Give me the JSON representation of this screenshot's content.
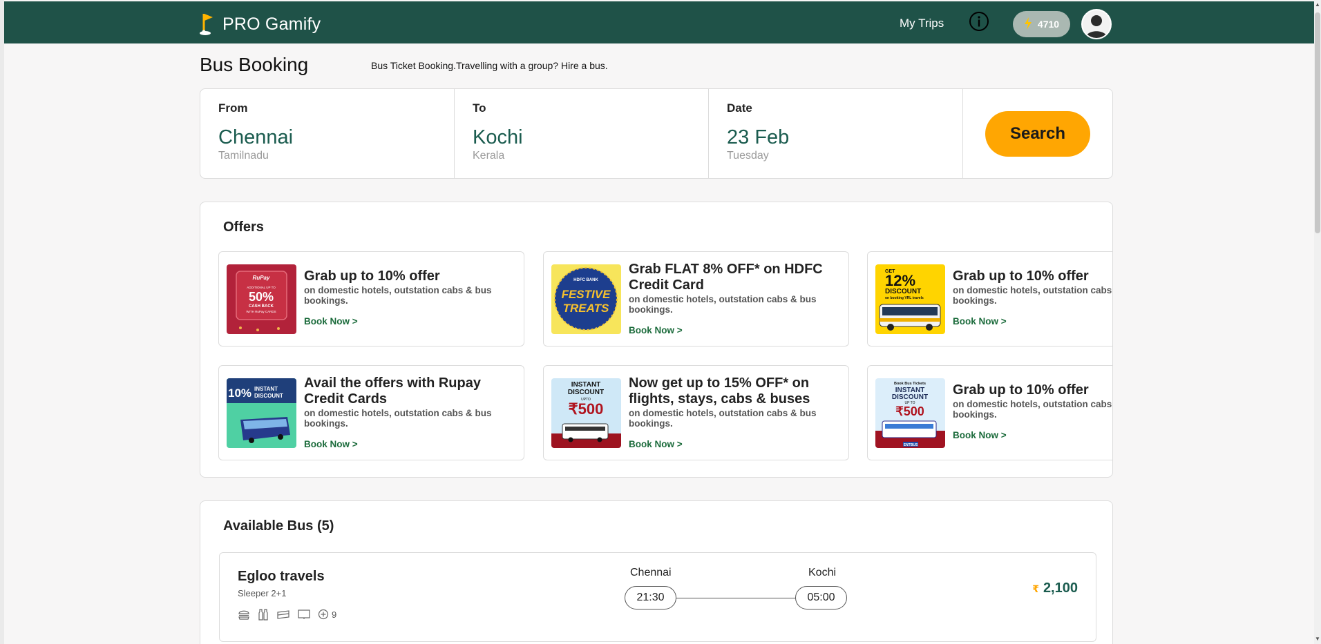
{
  "header": {
    "brand": "PRO Gamify",
    "nav_my_trips": "My Trips",
    "points": "4710",
    "colors": {
      "bar": "#1f5248",
      "accent": "#ffa602"
    }
  },
  "title": {
    "heading": "Bus Booking",
    "subheading": "Bus Ticket Booking.Travelling with a group? Hire a bus."
  },
  "search": {
    "from": {
      "label": "From",
      "value": "Chennai",
      "sub": "Tamilnadu"
    },
    "to": {
      "label": "To",
      "value": "Kochi",
      "sub": "Kerala"
    },
    "date": {
      "label": "Date",
      "value": "23 Feb",
      "sub": "Tuesday"
    },
    "button": "Search"
  },
  "offers": {
    "title": "Offers",
    "cards": [
      {
        "title": "Grab up to 10% offer",
        "desc": "on domestic hotels, outstation cabs & bus bookings.",
        "link": "Book Now >",
        "image": {
          "brand": "RuPay",
          "line1": "ADDITIONAL UP TO",
          "big": "50%",
          "line2": "CASH BACK",
          "line3": "WITH RuPay CARDS"
        }
      },
      {
        "title": "Grab FLAT 8% OFF* on HDFC Credit Card",
        "desc": "on domestic hotels, outstation cabs & bus bookings.",
        "link": "Book Now >",
        "image": {
          "brand": "HDFC BANK",
          "big1": "FESTIVE",
          "big2": "TREATS"
        }
      },
      {
        "title": "Grab up to 10% offer",
        "desc": "on domestic hotels, outstation cabs & bus bookings.",
        "link": "Book Now >",
        "image": {
          "line0": "GET",
          "big": "12%",
          "line1": "DISCOUNT",
          "line2": "on booking VRL travels"
        }
      },
      {
        "title": "Avail the offers with Rupay Credit Cards",
        "desc": "on domestic hotels, outstation cabs & bus bookings.",
        "link": "Book Now >",
        "image": {
          "big": "10%",
          "line1": "INSTANT",
          "line2": "DISCOUNT"
        }
      },
      {
        "title": "Now get up to 15% OFF* on flights, stays, cabs & buses",
        "desc": "on domestic hotels, outstation cabs & bus bookings.",
        "link": "Book Now >",
        "image": {
          "line1": "INSTANT",
          "line2": "DISCOUNT",
          "line3": "UPTO",
          "big": "₹500"
        }
      },
      {
        "title": "Grab up to 10% offer",
        "desc": "on domestic hotels, outstation cabs & bus bookings.",
        "link": "Book Now >",
        "image": {
          "line0": "Book Bus Tickets",
          "line1": "INSTANT",
          "line2": "DISCOUNT",
          "line3": "UP TO",
          "big": "₹500",
          "tag": "ENTBUS"
        }
      }
    ]
  },
  "buses": {
    "title": "Available Bus (5)",
    "items": [
      {
        "name": "Egloo travels",
        "type": "Sleeper 2+1",
        "amenities": [
          "burger-icon",
          "bottles-icon",
          "blanket-icon",
          "screen-icon"
        ],
        "more_amenities": "9",
        "from_city": "Chennai",
        "to_city": "Kochi",
        "depart": "21:30",
        "arrive": "05:00",
        "price_symbol": "₹",
        "price": "2,100"
      }
    ]
  }
}
